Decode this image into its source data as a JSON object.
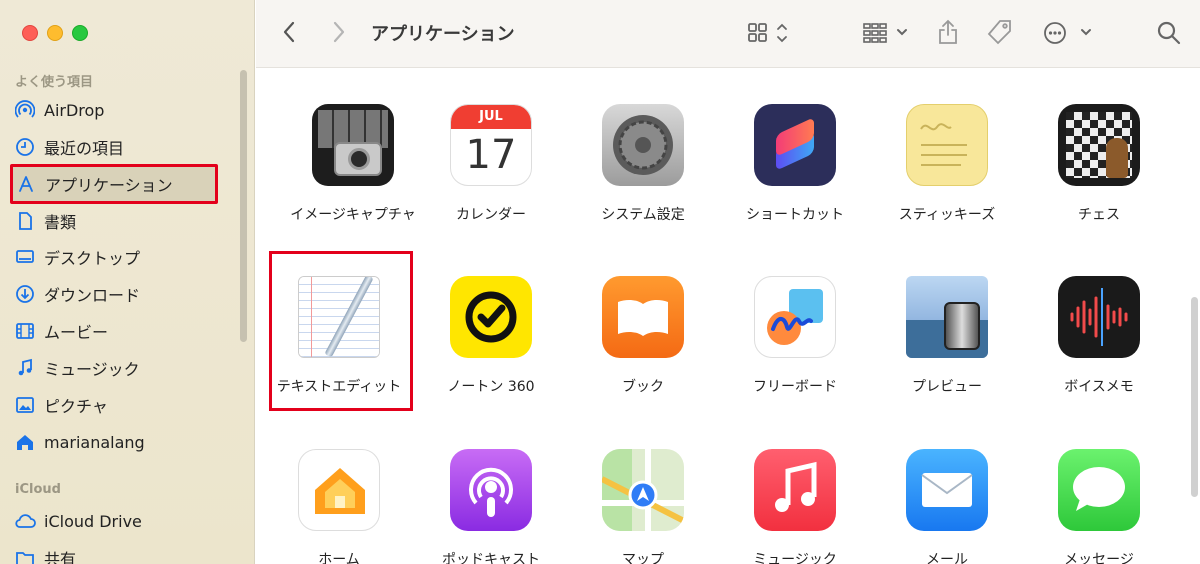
{
  "window": {
    "title": "アプリケーション"
  },
  "sidebar": {
    "favorites_title": "よく使う項目",
    "icloud_title": "iCloud",
    "items": [
      {
        "label": "AirDrop",
        "icon": "airdrop-icon"
      },
      {
        "label": "最近の項目",
        "icon": "clock-icon"
      },
      {
        "label": "アプリケーション",
        "icon": "applications-icon",
        "selected": true
      },
      {
        "label": "書類",
        "icon": "document-icon"
      },
      {
        "label": "デスクトップ",
        "icon": "desktop-icon"
      },
      {
        "label": "ダウンロード",
        "icon": "download-icon"
      },
      {
        "label": "ムービー",
        "icon": "film-icon"
      },
      {
        "label": "ミュージック",
        "icon": "music-note-icon"
      },
      {
        "label": "ピクチャ",
        "icon": "photo-icon"
      },
      {
        "label": "marianalang",
        "icon": "home-icon"
      }
    ],
    "icloud_items": [
      {
        "label": "iCloud Drive",
        "icon": "cloud-icon"
      },
      {
        "label": "共有",
        "icon": "shared-folder-icon"
      }
    ]
  },
  "toolbar": {
    "back_icon": "chevron-left-icon",
    "forward_icon": "chevron-right-icon",
    "view_icon": "grid-view-icon",
    "group_icon": "group-icon",
    "share_icon": "share-icon",
    "tag_icon": "tag-icon",
    "more_icon": "ellipsis-icon",
    "search_icon": "search-icon"
  },
  "apps": {
    "row1": [
      "イメージキャプチャ",
      "カレンダー",
      "システム設定",
      "ショートカット",
      "スティッキーズ",
      "チェス"
    ],
    "row2": [
      "テキストエディット",
      "ノートン 360",
      "ブック",
      "フリーボード",
      "プレビュー",
      "ボイスメモ"
    ],
    "row3": [
      "ホーム",
      "ポッドキャスト",
      "マップ",
      "ミュージック",
      "メール",
      "メッセージ"
    ]
  },
  "calendar_icon": {
    "month": "JUL",
    "day": "17"
  },
  "colors": {
    "highlight": "#e3001b",
    "accent": "#1a73e8"
  }
}
